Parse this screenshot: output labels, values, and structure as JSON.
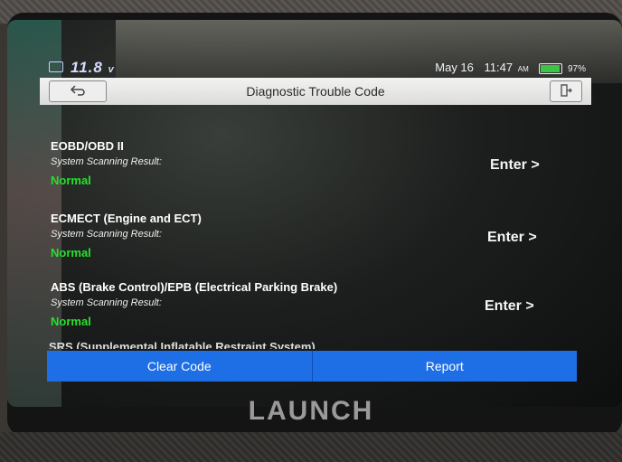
{
  "status": {
    "voltage": "11.8",
    "voltage_unit": "v",
    "date": "May 16",
    "time": "11:47",
    "ampm": "AM",
    "battery": "97%"
  },
  "title_bar": {
    "title": "Diagnostic Trouble Code"
  },
  "items": [
    {
      "name": "EOBD/OBD II",
      "subtitle": "System Scanning Result:",
      "status": "Normal",
      "action": "Enter >"
    },
    {
      "name": "ECMECT (Engine and ECT)",
      "subtitle": "System Scanning Result:",
      "status": "Normal",
      "action": "Enter >"
    },
    {
      "name": "ABS (Brake Control)/EPB (Electrical Parking Brake)",
      "subtitle": "System Scanning Result:",
      "status": "Normal",
      "action": "Enter >"
    }
  ],
  "partial_item": "SRS (Supplemental Inflatable Restraint System)",
  "buttons": {
    "clear": "Clear Code",
    "report": "Report"
  },
  "brand": "LAUNCH",
  "colors": {
    "accent": "#1e6fe6",
    "normal": "#28e02c"
  }
}
